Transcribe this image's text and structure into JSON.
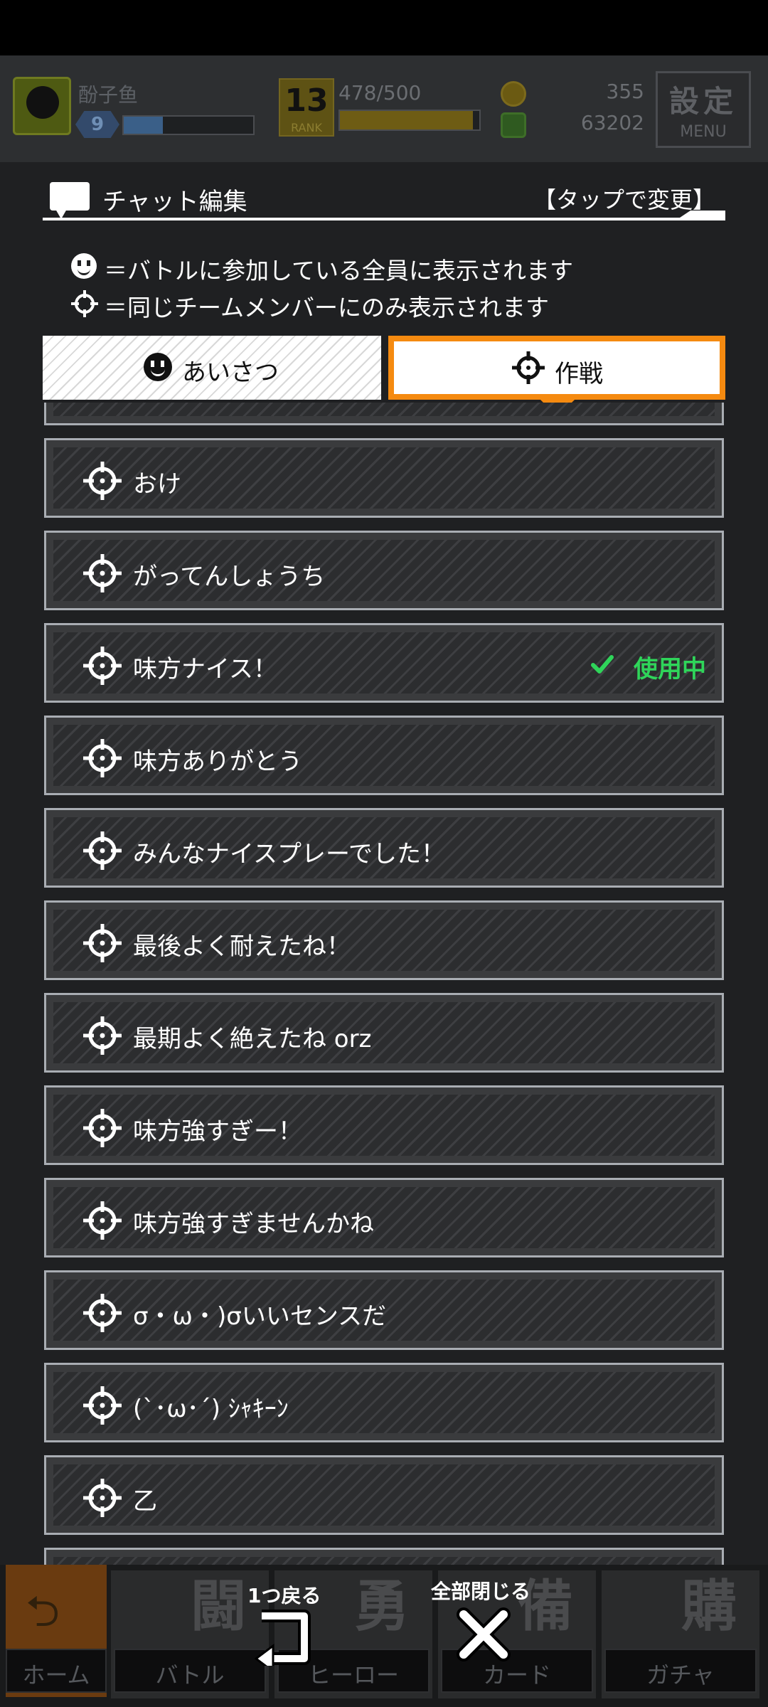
{
  "header": {
    "player_name": "酚子鱼",
    "level": "9",
    "exp_fraction": 0.3,
    "rank": "13",
    "rank_label": "RANK",
    "stamina": "478/500",
    "stamina_fraction": 0.956,
    "currency_1": "355",
    "currency_2": "63202",
    "menu_kanji": "設定",
    "menu_label": "MENU"
  },
  "dialog": {
    "title": "チャット編集",
    "tap_change": "【タップで変更】",
    "legend_all": "＝バトルに参加している全員に表示されます",
    "legend_team": "＝同じチームメンバーにのみ表示されます"
  },
  "tabs": {
    "greeting": "あいさつ",
    "strategy": "作戦",
    "active": "strategy"
  },
  "in_use_label": "使用中",
  "items": [
    {
      "text": "おけ",
      "in_use": false
    },
    {
      "text": "がってんしょうち",
      "in_use": false
    },
    {
      "text": "味方ナイス！",
      "in_use": true
    },
    {
      "text": "味方ありがとう",
      "in_use": false
    },
    {
      "text": "みんなナイスプレーでした！",
      "in_use": false
    },
    {
      "text": "最後よく耐えたね！",
      "in_use": false
    },
    {
      "text": "最期よく絶えたね orz",
      "in_use": false
    },
    {
      "text": "味方強すぎー！",
      "in_use": false
    },
    {
      "text": "味方強すぎませんかね",
      "in_use": false
    },
    {
      "text": "σ・ω・)σいいセンスだ",
      "in_use": false
    },
    {
      "text": "(`･ω･´) ｼｬｷｰﾝ",
      "in_use": false
    },
    {
      "text": "乙",
      "in_use": false
    }
  ],
  "controls": {
    "back_one": "1つ戻る",
    "close_all": "全部閉じる"
  },
  "nav": {
    "home": "ホーム",
    "battle": "バトル",
    "battle_big": "闘",
    "hero": "ヒーロー",
    "hero_big": "勇",
    "card": "カード",
    "card_big": "備",
    "gacha": "ガチャ",
    "gacha_big": "購"
  }
}
